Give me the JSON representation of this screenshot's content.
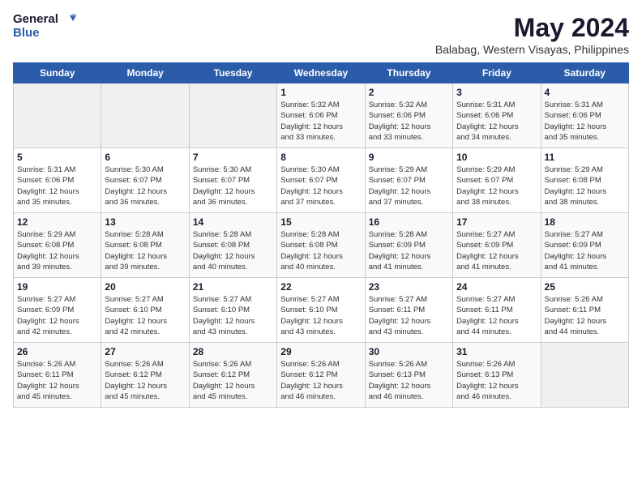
{
  "header": {
    "logo_line1": "General",
    "logo_line2": "Blue",
    "month_title": "May 2024",
    "subtitle": "Balabag, Western Visayas, Philippines"
  },
  "days_of_week": [
    "Sunday",
    "Monday",
    "Tuesday",
    "Wednesday",
    "Thursday",
    "Friday",
    "Saturday"
  ],
  "weeks": [
    [
      {
        "day": "",
        "content": ""
      },
      {
        "day": "",
        "content": ""
      },
      {
        "day": "",
        "content": ""
      },
      {
        "day": "1",
        "content": "Sunrise: 5:32 AM\nSunset: 6:06 PM\nDaylight: 12 hours\nand 33 minutes."
      },
      {
        "day": "2",
        "content": "Sunrise: 5:32 AM\nSunset: 6:06 PM\nDaylight: 12 hours\nand 33 minutes."
      },
      {
        "day": "3",
        "content": "Sunrise: 5:31 AM\nSunset: 6:06 PM\nDaylight: 12 hours\nand 34 minutes."
      },
      {
        "day": "4",
        "content": "Sunrise: 5:31 AM\nSunset: 6:06 PM\nDaylight: 12 hours\nand 35 minutes."
      }
    ],
    [
      {
        "day": "5",
        "content": "Sunrise: 5:31 AM\nSunset: 6:06 PM\nDaylight: 12 hours\nand 35 minutes."
      },
      {
        "day": "6",
        "content": "Sunrise: 5:30 AM\nSunset: 6:07 PM\nDaylight: 12 hours\nand 36 minutes."
      },
      {
        "day": "7",
        "content": "Sunrise: 5:30 AM\nSunset: 6:07 PM\nDaylight: 12 hours\nand 36 minutes."
      },
      {
        "day": "8",
        "content": "Sunrise: 5:30 AM\nSunset: 6:07 PM\nDaylight: 12 hours\nand 37 minutes."
      },
      {
        "day": "9",
        "content": "Sunrise: 5:29 AM\nSunset: 6:07 PM\nDaylight: 12 hours\nand 37 minutes."
      },
      {
        "day": "10",
        "content": "Sunrise: 5:29 AM\nSunset: 6:07 PM\nDaylight: 12 hours\nand 38 minutes."
      },
      {
        "day": "11",
        "content": "Sunrise: 5:29 AM\nSunset: 6:08 PM\nDaylight: 12 hours\nand 38 minutes."
      }
    ],
    [
      {
        "day": "12",
        "content": "Sunrise: 5:29 AM\nSunset: 6:08 PM\nDaylight: 12 hours\nand 39 minutes."
      },
      {
        "day": "13",
        "content": "Sunrise: 5:28 AM\nSunset: 6:08 PM\nDaylight: 12 hours\nand 39 minutes."
      },
      {
        "day": "14",
        "content": "Sunrise: 5:28 AM\nSunset: 6:08 PM\nDaylight: 12 hours\nand 40 minutes."
      },
      {
        "day": "15",
        "content": "Sunrise: 5:28 AM\nSunset: 6:08 PM\nDaylight: 12 hours\nand 40 minutes."
      },
      {
        "day": "16",
        "content": "Sunrise: 5:28 AM\nSunset: 6:09 PM\nDaylight: 12 hours\nand 41 minutes."
      },
      {
        "day": "17",
        "content": "Sunrise: 5:27 AM\nSunset: 6:09 PM\nDaylight: 12 hours\nand 41 minutes."
      },
      {
        "day": "18",
        "content": "Sunrise: 5:27 AM\nSunset: 6:09 PM\nDaylight: 12 hours\nand 41 minutes."
      }
    ],
    [
      {
        "day": "19",
        "content": "Sunrise: 5:27 AM\nSunset: 6:09 PM\nDaylight: 12 hours\nand 42 minutes."
      },
      {
        "day": "20",
        "content": "Sunrise: 5:27 AM\nSunset: 6:10 PM\nDaylight: 12 hours\nand 42 minutes."
      },
      {
        "day": "21",
        "content": "Sunrise: 5:27 AM\nSunset: 6:10 PM\nDaylight: 12 hours\nand 43 minutes."
      },
      {
        "day": "22",
        "content": "Sunrise: 5:27 AM\nSunset: 6:10 PM\nDaylight: 12 hours\nand 43 minutes."
      },
      {
        "day": "23",
        "content": "Sunrise: 5:27 AM\nSunset: 6:11 PM\nDaylight: 12 hours\nand 43 minutes."
      },
      {
        "day": "24",
        "content": "Sunrise: 5:27 AM\nSunset: 6:11 PM\nDaylight: 12 hours\nand 44 minutes."
      },
      {
        "day": "25",
        "content": "Sunrise: 5:26 AM\nSunset: 6:11 PM\nDaylight: 12 hours\nand 44 minutes."
      }
    ],
    [
      {
        "day": "26",
        "content": "Sunrise: 5:26 AM\nSunset: 6:11 PM\nDaylight: 12 hours\nand 45 minutes."
      },
      {
        "day": "27",
        "content": "Sunrise: 5:26 AM\nSunset: 6:12 PM\nDaylight: 12 hours\nand 45 minutes."
      },
      {
        "day": "28",
        "content": "Sunrise: 5:26 AM\nSunset: 6:12 PM\nDaylight: 12 hours\nand 45 minutes."
      },
      {
        "day": "29",
        "content": "Sunrise: 5:26 AM\nSunset: 6:12 PM\nDaylight: 12 hours\nand 46 minutes."
      },
      {
        "day": "30",
        "content": "Sunrise: 5:26 AM\nSunset: 6:13 PM\nDaylight: 12 hours\nand 46 minutes."
      },
      {
        "day": "31",
        "content": "Sunrise: 5:26 AM\nSunset: 6:13 PM\nDaylight: 12 hours\nand 46 minutes."
      },
      {
        "day": "",
        "content": ""
      }
    ]
  ]
}
